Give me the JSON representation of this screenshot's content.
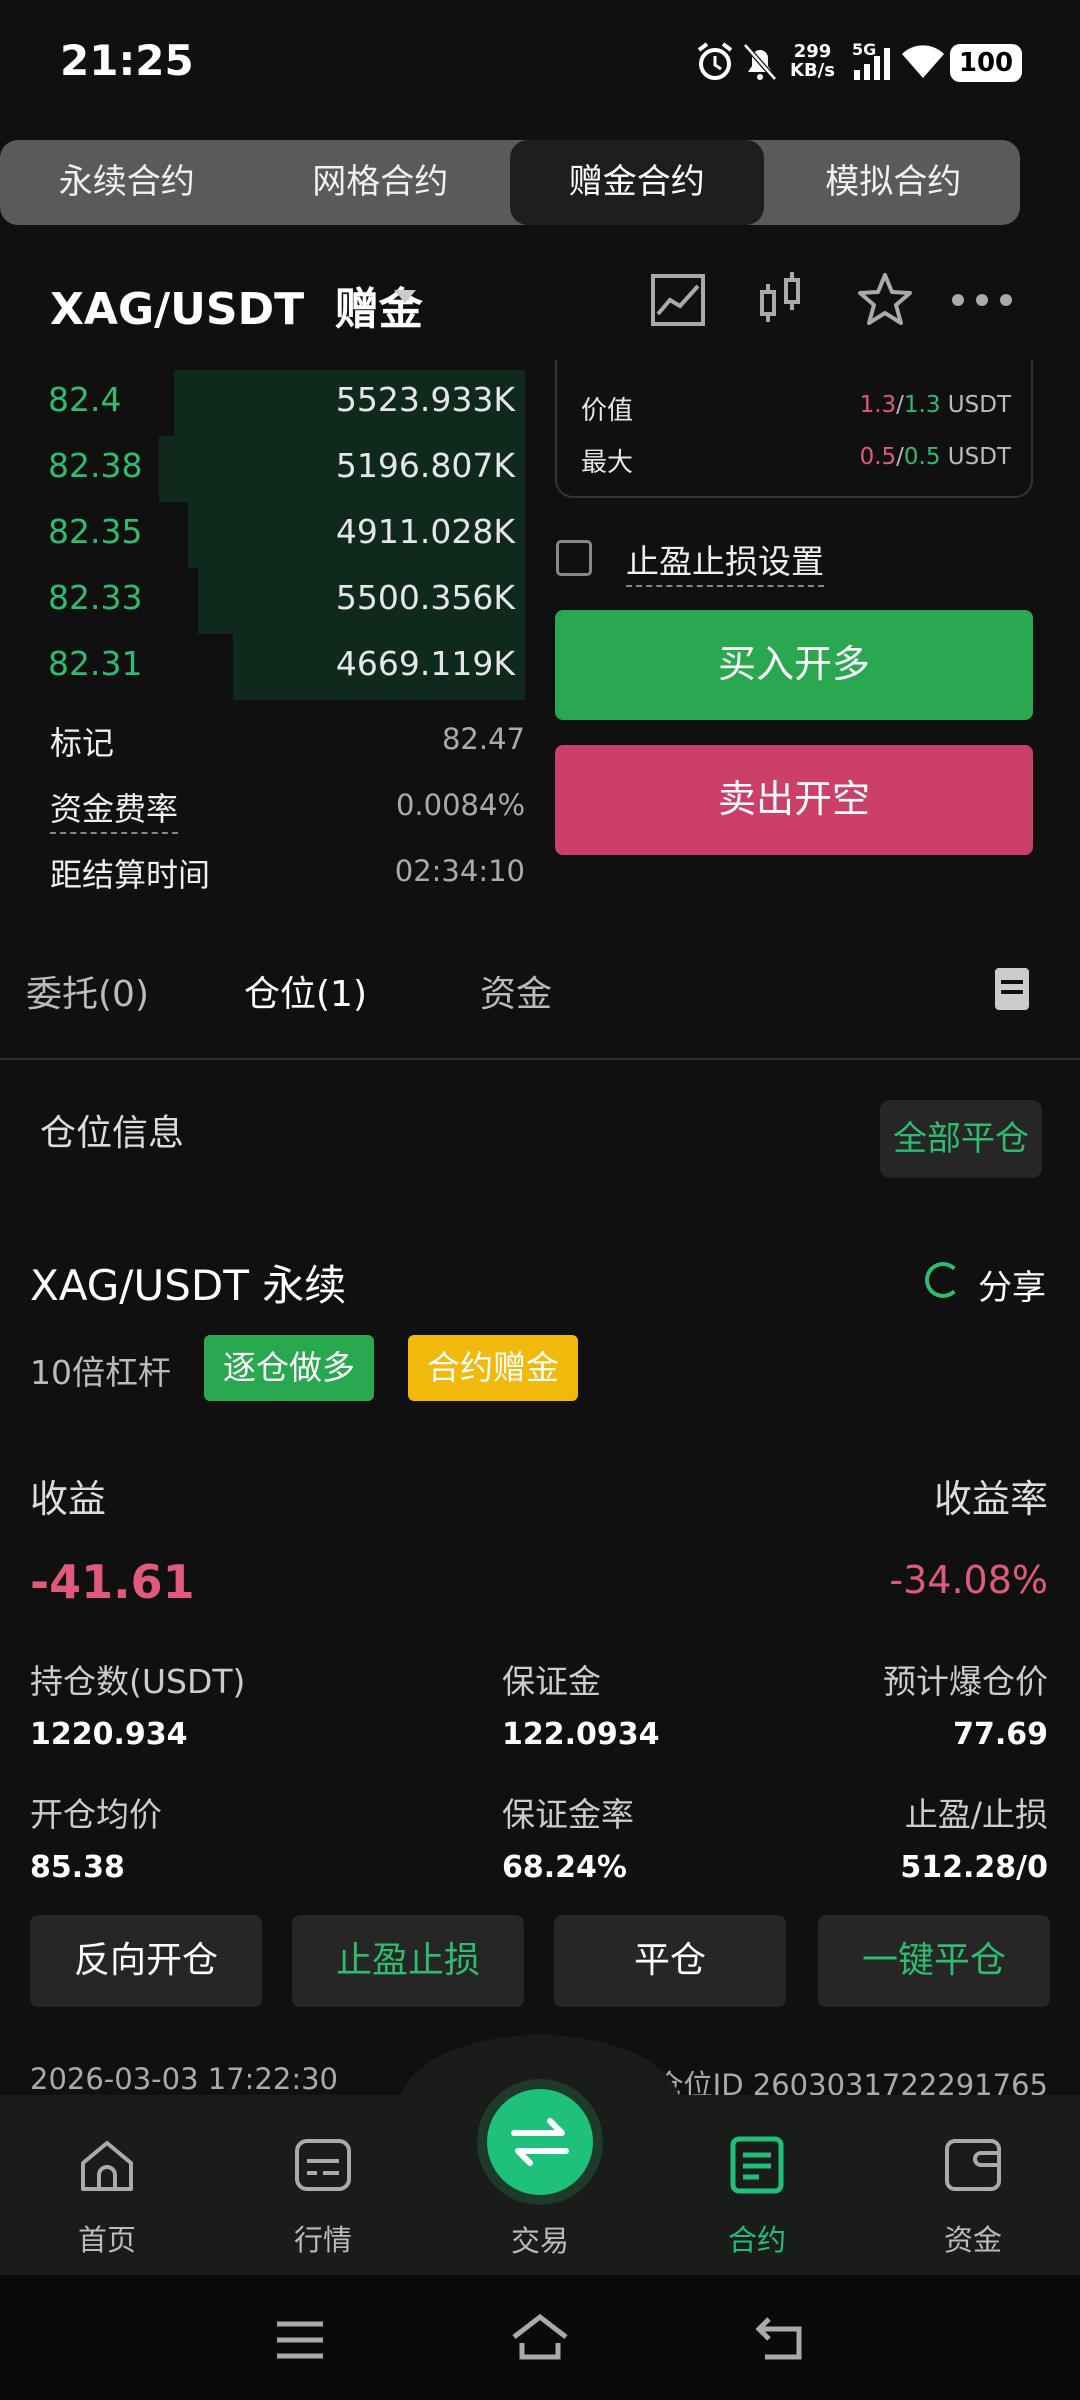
{
  "status": {
    "time": "21:25",
    "net_speed_value": "299",
    "net_speed_unit": "KB/s",
    "network": "5G",
    "battery": "100"
  },
  "mode_tabs": [
    "永续合约",
    "网格合约",
    "赠金合约",
    "模拟合约"
  ],
  "pair": {
    "title": "XAG/USDT  赠金"
  },
  "orderbook": {
    "rows": [
      {
        "price": "82.4",
        "qty": "5523.933K",
        "depth": 0.71
      },
      {
        "price": "82.38",
        "qty": "5196.807K",
        "depth": 0.74
      },
      {
        "price": "82.35",
        "qty": "4911.028K",
        "depth": 0.68
      },
      {
        "price": "82.33",
        "qty": "5500.356K",
        "depth": 0.66
      },
      {
        "price": "82.31",
        "qty": "4669.119K",
        "depth": 0.59
      }
    ]
  },
  "info": {
    "mark_label": "标记",
    "mark_value": "82.47",
    "funding_label": "资金费率",
    "funding_value": "0.0084%",
    "settle_label": "距结算时间",
    "settle_value": "02:34:10"
  },
  "value_box": {
    "value_label": "价值",
    "value_red": "1.3",
    "value_green": "1.3",
    "value_unit": "USDT",
    "max_label": "最大",
    "max_red": "0.5",
    "max_green": "0.5",
    "max_unit": "USDT"
  },
  "order": {
    "tpsl_label": "止盈止损设置",
    "buy_label": "买入开多",
    "sell_label": "卖出开空"
  },
  "pos_tabs": [
    "委托(0)",
    "仓位(1)",
    "资金"
  ],
  "position": {
    "section_title": "仓位信息",
    "close_all": "全部平仓",
    "name": "XAG/USDT 永续",
    "share": "分享",
    "leverage": "10倍杠杆",
    "tag_side": "逐仓做多",
    "tag_bonus": "合约赠金",
    "pnl_label": "收益",
    "roe_label": "收益率",
    "pnl": "-41.61",
    "roe": "-34.08%",
    "stats": {
      "size_label": "持仓数(USDT)",
      "size": "1220.934",
      "margin_label": "保证金",
      "margin": "122.0934",
      "liq_label": "预计爆仓价",
      "liq": "77.69",
      "entry_label": "开仓均价",
      "entry": "85.38",
      "margin_rate_label": "保证金率",
      "margin_rate": "68.24%",
      "tpsl_label": "止盈/止损",
      "tpsl": "512.28/0"
    },
    "actions": [
      "反向开仓",
      "止盈止损",
      "平仓",
      "一键平仓"
    ],
    "timestamp": "2026-03-03 17:22:30",
    "position_id": "仓位ID 2603031722291765"
  },
  "bottom_nav": [
    "首页",
    "行情",
    "交易",
    "合约",
    "资金"
  ],
  "colors": {
    "green": "#2ebd6f",
    "red": "#e05b7b",
    "bonus": "#f0b90b"
  }
}
